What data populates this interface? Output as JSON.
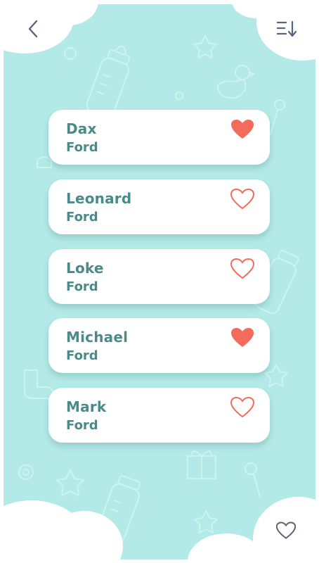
{
  "header": {
    "back_icon": "chevron-left-icon",
    "sort_icon": "sort-descending-icon"
  },
  "names": [
    {
      "first": "Dax",
      "last": "Ford",
      "favorite": true
    },
    {
      "first": "Leonard",
      "last": "Ford",
      "favorite": false
    },
    {
      "first": "Loke",
      "last": "Ford",
      "favorite": false
    },
    {
      "first": "Michael",
      "last": "Ford",
      "favorite": true
    },
    {
      "first": "Mark",
      "last": "Ford",
      "favorite": false
    }
  ],
  "footer": {
    "favorites_icon": "heart-outline-icon"
  },
  "colors": {
    "background": "#b3e9e6",
    "card": "#ffffff",
    "name_text": "#4a8a88",
    "heart": "#f26b5b",
    "nav_icon": "#5a6478"
  }
}
